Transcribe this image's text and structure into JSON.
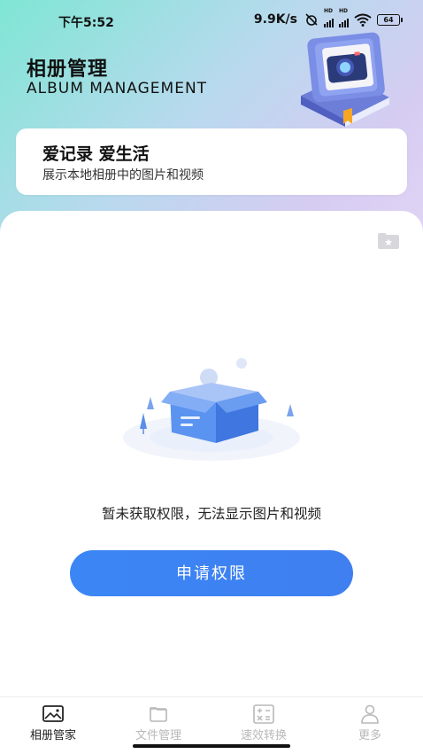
{
  "status_bar": {
    "time": "下午5:52",
    "net_speed": "9.9K/s",
    "battery": "64"
  },
  "header": {
    "title": "相册管理",
    "subtitle": "ALBUM MANAGEMENT"
  },
  "slogan": {
    "title": "爱记录 爱生活",
    "description": "展示本地相册中的图片和视频"
  },
  "main": {
    "empty_message": "暂未获取权限，无法显示图片和视频",
    "request_button_label": "申请权限"
  },
  "bottom_nav": {
    "items": [
      {
        "label": "相册管家",
        "icon": "album-icon",
        "active": true
      },
      {
        "label": "文件管理",
        "icon": "folder-icon",
        "active": false
      },
      {
        "label": "速效转换",
        "icon": "calculator-icon",
        "active": false
      },
      {
        "label": "更多",
        "icon": "person-icon",
        "active": false
      }
    ]
  },
  "colors": {
    "primary": "#3b86f5",
    "header_gradient_start": "#7fe6d4",
    "header_gradient_end": "#e3d6f5",
    "nav_inactive": "#b8b8b8"
  }
}
